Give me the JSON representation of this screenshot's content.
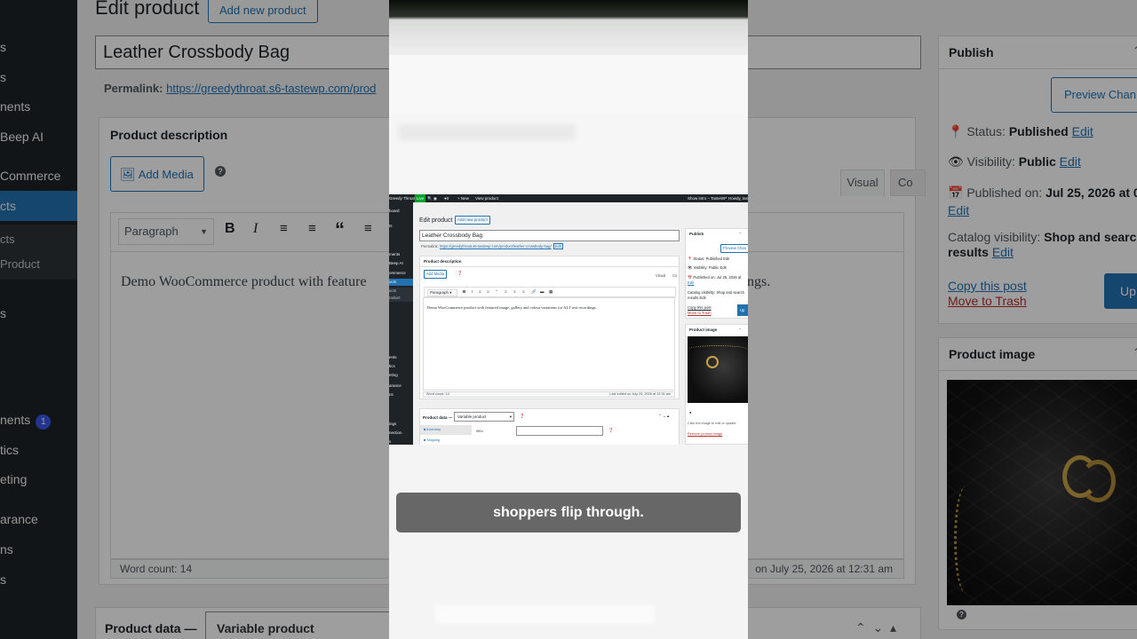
{
  "background": {
    "sidebar": [
      "s",
      "s",
      "nents",
      "Beep AI",
      "Commerce",
      "cts",
      "cts",
      "Product",
      "s",
      "nents",
      "tics",
      "eting",
      "arance",
      "ns",
      "s"
    ],
    "sidebar_badge": "1",
    "page_title": "Edit product",
    "add_new": "Add new product",
    "title_value": "Leather Crossbody Bag",
    "permalink_label": "Permalink:",
    "permalink_url": "https://greedythroat.s6-tastewp.com/prod",
    "description_heading": "Product description",
    "add_media": "Add Media",
    "tab_visual": "Visual",
    "tab_code": "Co",
    "format_select": "Paragraph",
    "content_text": "Demo WooCommerce product with feature",
    "content_text_tail": "ngs.",
    "word_count": "Word count: 14",
    "last_edited_tail": "on July 25, 2026 at 12:31 am",
    "product_data_label": "Product data —",
    "product_type": "Variable product",
    "publish_heading": "Publish",
    "preview_changes": "Preview Chan",
    "status_label": "Status:",
    "status_value": "Published",
    "visibility_label": "Visibility:",
    "visibility_value": "Public",
    "published_on_label": "Published on:",
    "published_on_value": "Jul 25, 2026 at 0",
    "edit_link": "Edit",
    "catalog_visibility_label": "Catalog visibility:",
    "catalog_visibility_value": "Shop and search results",
    "copy_post": "Copy this post",
    "move_trash": "Move to Trash",
    "update_button": "Up",
    "product_image_heading": "Product image"
  },
  "mini": {
    "adminbar": {
      "site": "Greedy Throat",
      "live": "Live",
      "count": "0",
      "new": "+ New",
      "view": "View product",
      "right1": "Show intro – TasteWP",
      "right2": "Howdy, tast"
    },
    "sidebar": [
      "board",
      "",
      "ts",
      "ments",
      "Beep AI",
      "ommerce",
      "ucts",
      "ucts",
      "roduct",
      "",
      "s",
      "",
      "",
      "ents",
      "tics",
      "eting",
      "arance",
      "ns",
      "",
      "ings",
      "nection",
      "s"
    ],
    "page_title": "Edit product",
    "add_new": "Add new product",
    "title_value": "Leather Crossbody Bag",
    "permalink_label": "Permalink:",
    "permalink_url": "https://greedythroat.s6-tastewp.com/product/leather-crossbody-bag/",
    "permalink_edit": "Edit",
    "description_heading": "Product description",
    "add_media": "Add Media",
    "tab_visual": "Visual",
    "tab_code": "Co",
    "format_select": "Paragraph",
    "content_text": "Demo WooCommerce product with featured image, gallery and colour variations for ALT text recordings.",
    "word_count": "Word count: 14",
    "last_edited": "Last edited on July 25, 2026 at 12:31 am",
    "product_data_label": "Product data —",
    "product_type": "Variable product",
    "inventory_tab": "Inventory",
    "shipping_tab": "Shipping",
    "sku_label": "SKU",
    "publish_heading": "Publish",
    "preview_changes": "Preview Chan",
    "status": "Status: Published Edit",
    "visibility": "Visibility: Public Edit",
    "published_on": "Published on: Jul 25, 2026 at",
    "edit_link": "Edit",
    "catalog_visibility": "Catalog visibility: Shop and search",
    "catalog_visibility_tail": "results Edit",
    "copy_post": "Copy this post",
    "move_trash": "Move to Trash",
    "update_button": "Up",
    "product_image_heading": "Product image",
    "image_hint": "Click the image to edit or update",
    "remove_image": "Remove product image"
  },
  "caption": "shoppers flip through.",
  "colors": {
    "wp_blue": "#2271b1",
    "admin_dark": "#1d2327",
    "trash_red": "#b32d2e",
    "gold": "#c9a24a"
  }
}
